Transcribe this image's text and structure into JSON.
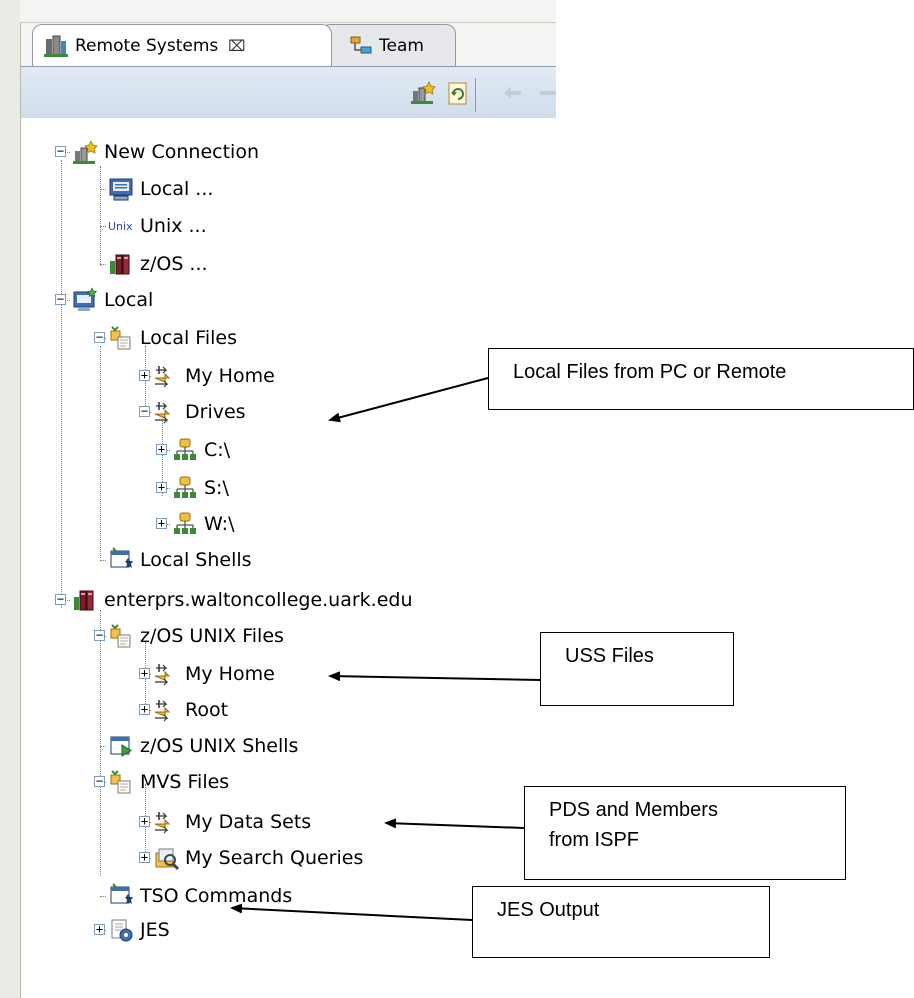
{
  "tabs": [
    {
      "label": "Remote Systems",
      "close": "⌧",
      "active": true
    },
    {
      "label": "Team",
      "active": false
    }
  ],
  "tree": [
    {
      "label": "New Connection",
      "level": 0,
      "expander": "minus",
      "icon": "new-connection-icon"
    },
    {
      "label": "Local ...",
      "level": 1,
      "expander": "none",
      "icon": "monitor-icon"
    },
    {
      "label": "Unix ...",
      "level": 1,
      "expander": "none",
      "icon": "unix-icon",
      "icon_text": "Unix"
    },
    {
      "label": "z/OS ...",
      "level": 1,
      "expander": "none",
      "icon": "mainframe-icon"
    },
    {
      "label": "Local",
      "level": 0,
      "expander": "minus",
      "icon": "local-host-icon"
    },
    {
      "label": "Local Files",
      "level": 1,
      "expander": "minus",
      "icon": "files-subsystem-icon"
    },
    {
      "label": "My Home",
      "level": 2,
      "expander": "plus",
      "icon": "filter-icon"
    },
    {
      "label": "Drives",
      "level": 2,
      "expander": "minus",
      "icon": "filter-icon"
    },
    {
      "label": "C:\\",
      "level": 3,
      "expander": "plus",
      "icon": "drive-icon"
    },
    {
      "label": "S:\\",
      "level": 3,
      "expander": "plus",
      "icon": "drive-icon"
    },
    {
      "label": "W:\\",
      "level": 3,
      "expander": "plus",
      "icon": "drive-icon"
    },
    {
      "label": "Local Shells",
      "level": 1,
      "expander": "none",
      "icon": "shells-icon"
    },
    {
      "label": "enterprs.waltoncollege.uark.edu",
      "level": 0,
      "expander": "minus",
      "icon": "mainframe-icon"
    },
    {
      "label": "z/OS UNIX Files",
      "level": 1,
      "expander": "minus",
      "icon": "files-subsystem-icon"
    },
    {
      "label": "My Home",
      "level": 2,
      "expander": "plus",
      "icon": "filter-icon"
    },
    {
      "label": "Root",
      "level": 2,
      "expander": "plus",
      "icon": "filter-icon"
    },
    {
      "label": "z/OS UNIX Shells",
      "level": 1,
      "expander": "none",
      "icon": "unix-shells-icon"
    },
    {
      "label": "MVS Files",
      "level": 1,
      "expander": "minus",
      "icon": "files-subsystem-icon"
    },
    {
      "label": "My Data Sets",
      "level": 2,
      "expander": "plus",
      "icon": "filter-icon"
    },
    {
      "label": "My Search Queries",
      "level": 2,
      "expander": "plus",
      "icon": "search-queries-icon"
    },
    {
      "label": "TSO Commands",
      "level": 1,
      "expander": "none",
      "icon": "shells-icon"
    },
    {
      "label": "JES",
      "level": 1,
      "expander": "plus",
      "icon": "jes-icon"
    }
  ],
  "callouts": [
    {
      "text": "Local Files from PC or Remote"
    },
    {
      "text": "USS Files"
    },
    {
      "text": "PDS and Members\nfrom ISPF"
    },
    {
      "text": "JES Output"
    }
  ]
}
